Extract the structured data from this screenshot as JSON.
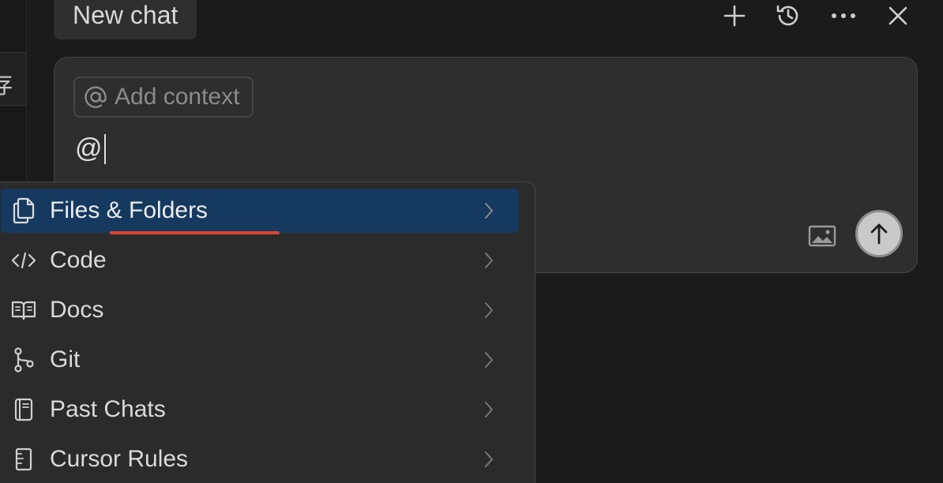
{
  "header": {
    "tab_title": "New chat",
    "buttons": [
      {
        "name": "new-chat-button",
        "icon": "plus-icon"
      },
      {
        "name": "history-button",
        "icon": "history-icon"
      },
      {
        "name": "more-button",
        "icon": "ellipsis-icon"
      },
      {
        "name": "close-button",
        "icon": "close-icon"
      }
    ]
  },
  "left_panel": {
    "tab_glyph": "存"
  },
  "composer": {
    "add_context_label": "Add context",
    "add_context_icon": "at-sign-icon",
    "input_value": "@",
    "image_icon": "image-icon",
    "send_icon": "arrow-up-icon"
  },
  "menu": {
    "items": [
      {
        "label": "Files & Folders",
        "icon": "files-icon",
        "selected": true
      },
      {
        "label": "Code",
        "icon": "code-icon",
        "selected": false
      },
      {
        "label": "Docs",
        "icon": "book-icon",
        "selected": false
      },
      {
        "label": "Git",
        "icon": "git-branch-icon",
        "selected": false
      },
      {
        "label": "Past Chats",
        "icon": "notebook-icon",
        "selected": false
      },
      {
        "label": "Cursor Rules",
        "icon": "rules-icon",
        "selected": false
      }
    ]
  },
  "colors": {
    "background": "#1b1b1b",
    "composer_bg": "#2e2e2e",
    "menu_bg": "#2b2b2b",
    "selected_item": "#163a5f",
    "annotation_underline": "#e0452e"
  }
}
